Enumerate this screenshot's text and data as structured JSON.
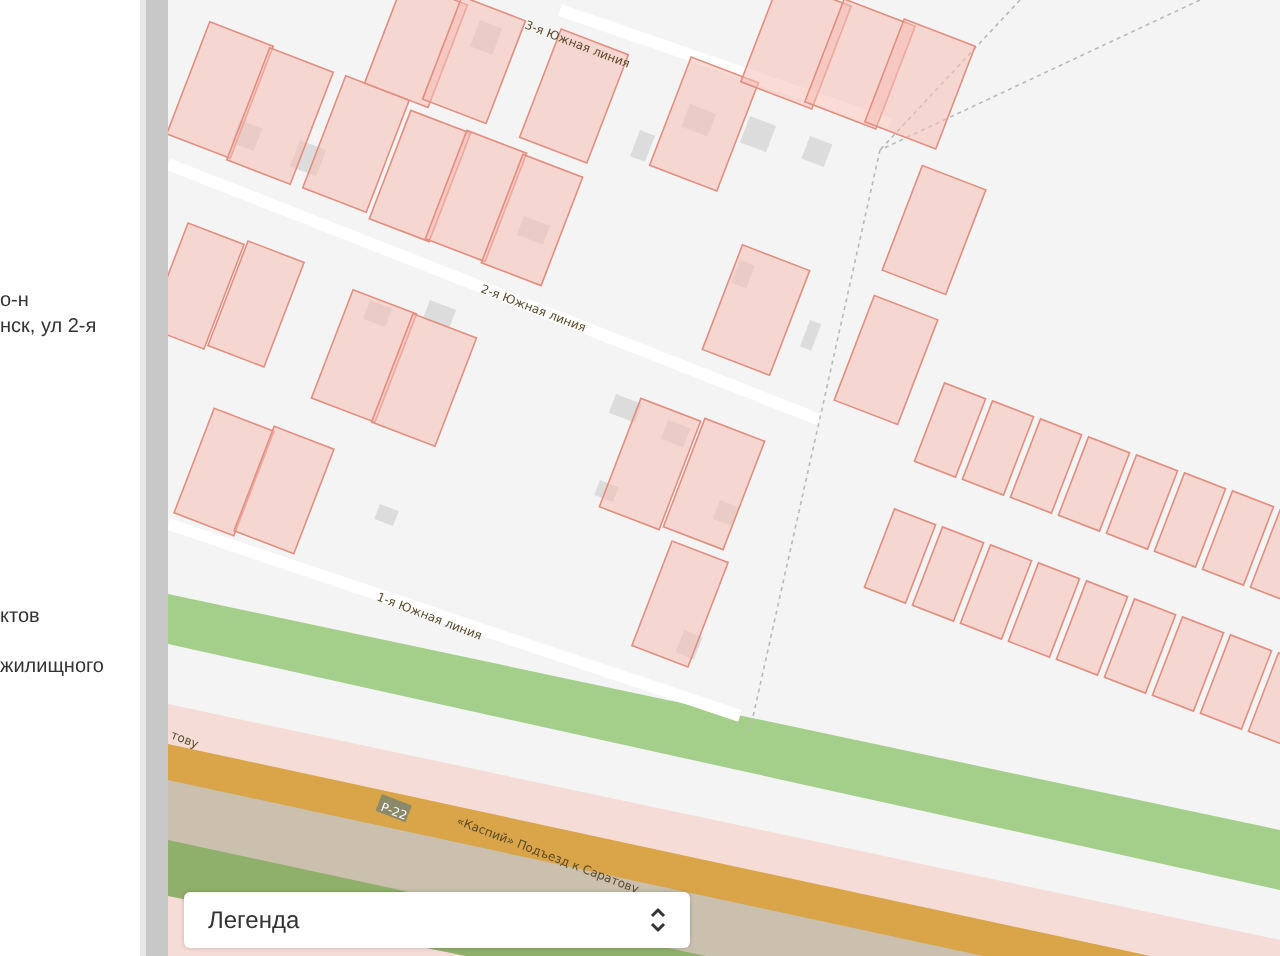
{
  "sidebar": {
    "text_lines": [
      "о-н",
      "нск, ул 2-я",
      "ктов",
      "жилищного"
    ]
  },
  "map": {
    "street_labels": [
      "3-я Южная линия",
      "2-я Южная линия",
      "1-я Южная линия",
      "«Каспий» Подъезд к Саратову",
      "тову"
    ],
    "road_badge": "Р-22",
    "legend": {
      "label": "Легенда"
    }
  }
}
